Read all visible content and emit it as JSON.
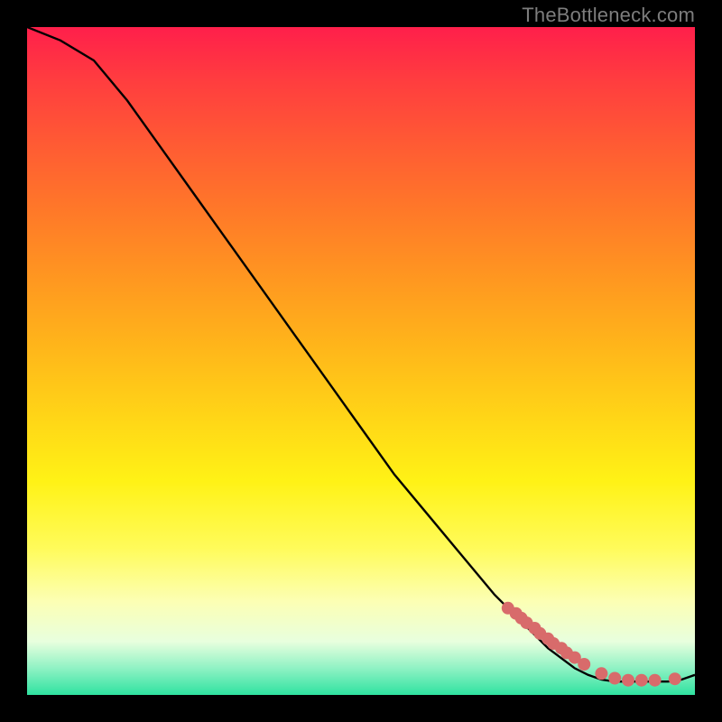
{
  "watermark": "TheBottleneck.com",
  "chart_data": {
    "type": "line",
    "title": "",
    "xlabel": "",
    "ylabel": "",
    "xlim": [
      0,
      100
    ],
    "ylim": [
      0,
      100
    ],
    "x": [
      0,
      5,
      10,
      15,
      20,
      25,
      30,
      35,
      40,
      45,
      50,
      55,
      60,
      65,
      70,
      72,
      74,
      76,
      78,
      80,
      82,
      84,
      86,
      88,
      90,
      92,
      94,
      96,
      98,
      100
    ],
    "values": [
      100,
      98,
      95,
      89,
      82,
      75,
      68,
      61,
      54,
      47,
      40,
      33,
      27,
      21,
      15,
      13,
      11,
      9,
      7,
      5.5,
      4,
      3,
      2.3,
      2,
      2,
      2,
      2,
      2,
      2.3,
      3
    ],
    "marker_points": {
      "x": [
        72,
        73.2,
        74,
        74.8,
        76,
        76.8,
        78,
        78.8,
        80,
        80.8,
        82,
        83.4,
        86,
        88,
        90,
        92,
        94,
        97
      ],
      "y": [
        13,
        12.2,
        11.5,
        10.8,
        10,
        9.2,
        8.4,
        7.7,
        7,
        6.3,
        5.6,
        4.6,
        3.2,
        2.5,
        2.2,
        2.2,
        2.2,
        2.4
      ]
    },
    "marker_color": "#d86b6b",
    "line_color": "#000000"
  }
}
